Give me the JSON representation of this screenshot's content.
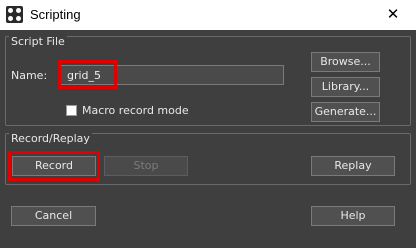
{
  "window": {
    "title": "Scripting",
    "close_glyph": "✕"
  },
  "script_file": {
    "group_title": "Script File",
    "name_label": "Name:",
    "name_value": "grid_5",
    "browse_label": "Browse...",
    "library_label": "Library...",
    "generate_label": "Generate...",
    "macro_label": "Macro record mode",
    "macro_checked": false
  },
  "record_replay": {
    "group_title": "Record/Replay",
    "record_label": "Record",
    "stop_label": "Stop",
    "replay_label": "Replay"
  },
  "footer": {
    "cancel_label": "Cancel",
    "help_label": "Help"
  },
  "colors": {
    "background": "#3f3f3f",
    "highlight": "#e00000"
  }
}
